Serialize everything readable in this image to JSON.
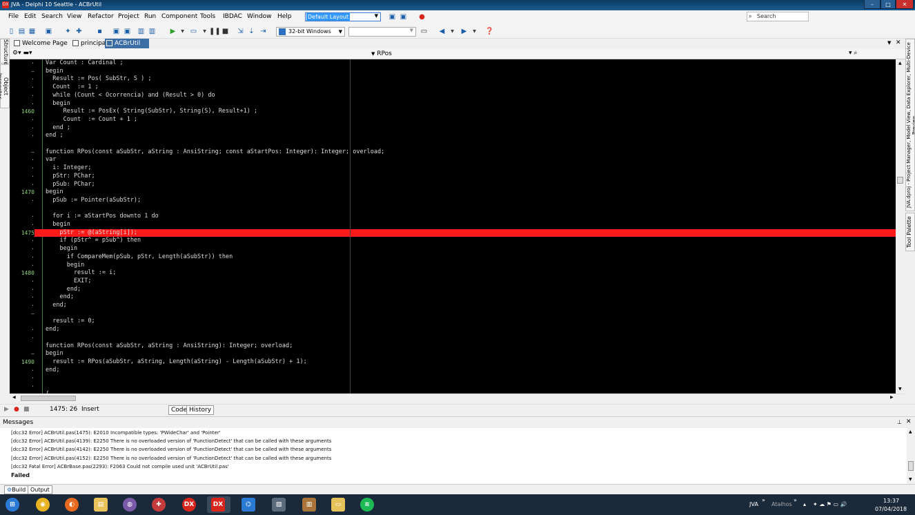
{
  "window": {
    "title": "JVA - Delphi 10 Seattle - ACBrUtil",
    "app_icon": "DX",
    "controls": [
      "minimize-icon",
      "maximize-icon",
      "close-icon"
    ],
    "accent": "#d9261c"
  },
  "menu": {
    "items": [
      "File",
      "Edit",
      "Search",
      "View",
      "Refactor",
      "Project",
      "Run",
      "Component",
      "Tools",
      "IBDAC",
      "Window",
      "Help"
    ],
    "layout_value": "Default Layout",
    "search_placeholder": "Search"
  },
  "toolbar": {
    "platform": "32-bit Windows",
    "config": ""
  },
  "tabs": [
    {
      "label": "Welcome Page",
      "active": false
    },
    {
      "label": "principal",
      "active": false
    },
    {
      "label": "ACBrUtil",
      "active": true
    }
  ],
  "left_panels": [
    "Structure",
    "Object Inspector"
  ],
  "right_panels": [
    "Tool Palette",
    "JVA.dproj - Project Manager, Model View, Data Explorer, Multi-Device Preview"
  ],
  "editor": {
    "procedure": "RPos",
    "highlight_color": "#ff1a1a",
    "gutter": [
      "·",
      "–",
      "·",
      "·",
      "·",
      "·",
      "1460",
      "·",
      "·",
      "·",
      "",
      "–",
      "·",
      "·",
      "·",
      "·",
      "1470",
      "·",
      "",
      "·",
      "·",
      "1475",
      "·",
      "·",
      "·",
      "·",
      "1480",
      "·",
      "·",
      "·",
      "·",
      "–",
      "",
      "·",
      "·",
      "",
      "–",
      "1490",
      "·",
      "·",
      "·",
      "·",
      "·"
    ],
    "lines": [
      "Var Count : Cardinal ;",
      "begin",
      "  Result := Pos( SubStr, S ) ;",
      "  Count  := 1 ;",
      "  while (Count < Ocorrencia) and (Result > 0) do",
      "  begin",
      "     Result := PosEx( String(SubStr), String(S), Result+1) ;",
      "     Count  := Count + 1 ;",
      "  end ;",
      "end ;",
      "",
      "function RPos(const aSubStr, aString : AnsiString; const aStartPos: Integer): Integer; overload;",
      "var",
      "  i: Integer;",
      "  pStr: PChar;",
      "  pSub: PChar;",
      "begin",
      "  pSub := Pointer(aSubStr);",
      "",
      "  for i := aStartPos downto 1 do",
      "  begin",
      "    pStr := @(aString[i]);",
      "    if (pStr^ = pSub^) then",
      "    begin",
      "      if CompareMem(pSub, pStr, Length(aSubStr)) then",
      "      begin",
      "        result := i;",
      "        EXIT;",
      "      end;",
      "    end;",
      "  end;",
      "",
      "  result := 0;",
      "end;",
      "",
      "function RPos(const aSubStr, aString : AnsiString): Integer; overload;",
      "begin",
      "  result := RPos(aSubStr, aString, Length(aString) - Length(aSubStr) + 1);",
      "end;",
      "",
      "",
      "{-------------------------------------------------------------------------------",
      ""
    ]
  },
  "status": {
    "position": "1475: 26",
    "mode": "Insert",
    "view_tabs": [
      "Code",
      "History"
    ]
  },
  "messages": {
    "title": "Messages",
    "items": [
      "[dcc32 Error] ACBrUtil.pas(1475): E2010 Incompatible types: 'PWideChar' and 'Pointer'",
      "[dcc32 Error] ACBrUtil.pas(4139): E2250 There is no overloaded version of 'FunctionDetect' that can be called with these arguments",
      "[dcc32 Error] ACBrUtil.pas(4142): E2250 There is no overloaded version of 'FunctionDetect' that can be called with these arguments",
      "[dcc32 Error] ACBrUtil.pas(4152): E2250 There is no overloaded version of 'FunctionDetect' that can be called with these arguments",
      "[dcc32 Fatal Error] ACBrBase.pas(2293): F2063 Could not compile used unit 'ACBrUtil.pas'"
    ],
    "result": "Failed",
    "tabs": [
      "Build",
      "Output"
    ]
  },
  "taskbar": {
    "apps": [
      "windows-icon",
      "chrome-icon",
      "firefox-icon",
      "explorer-icon",
      "discord-icon",
      "app-icon",
      "delphi-icon",
      "delphi-active-icon",
      "vscode-icon",
      "terminal-icon",
      "archive-icon",
      "folder-icon",
      "spotify-icon"
    ],
    "tray_labels": [
      "JVA",
      "Atalhos"
    ],
    "time": "13:37",
    "date": "07/04/2018"
  }
}
